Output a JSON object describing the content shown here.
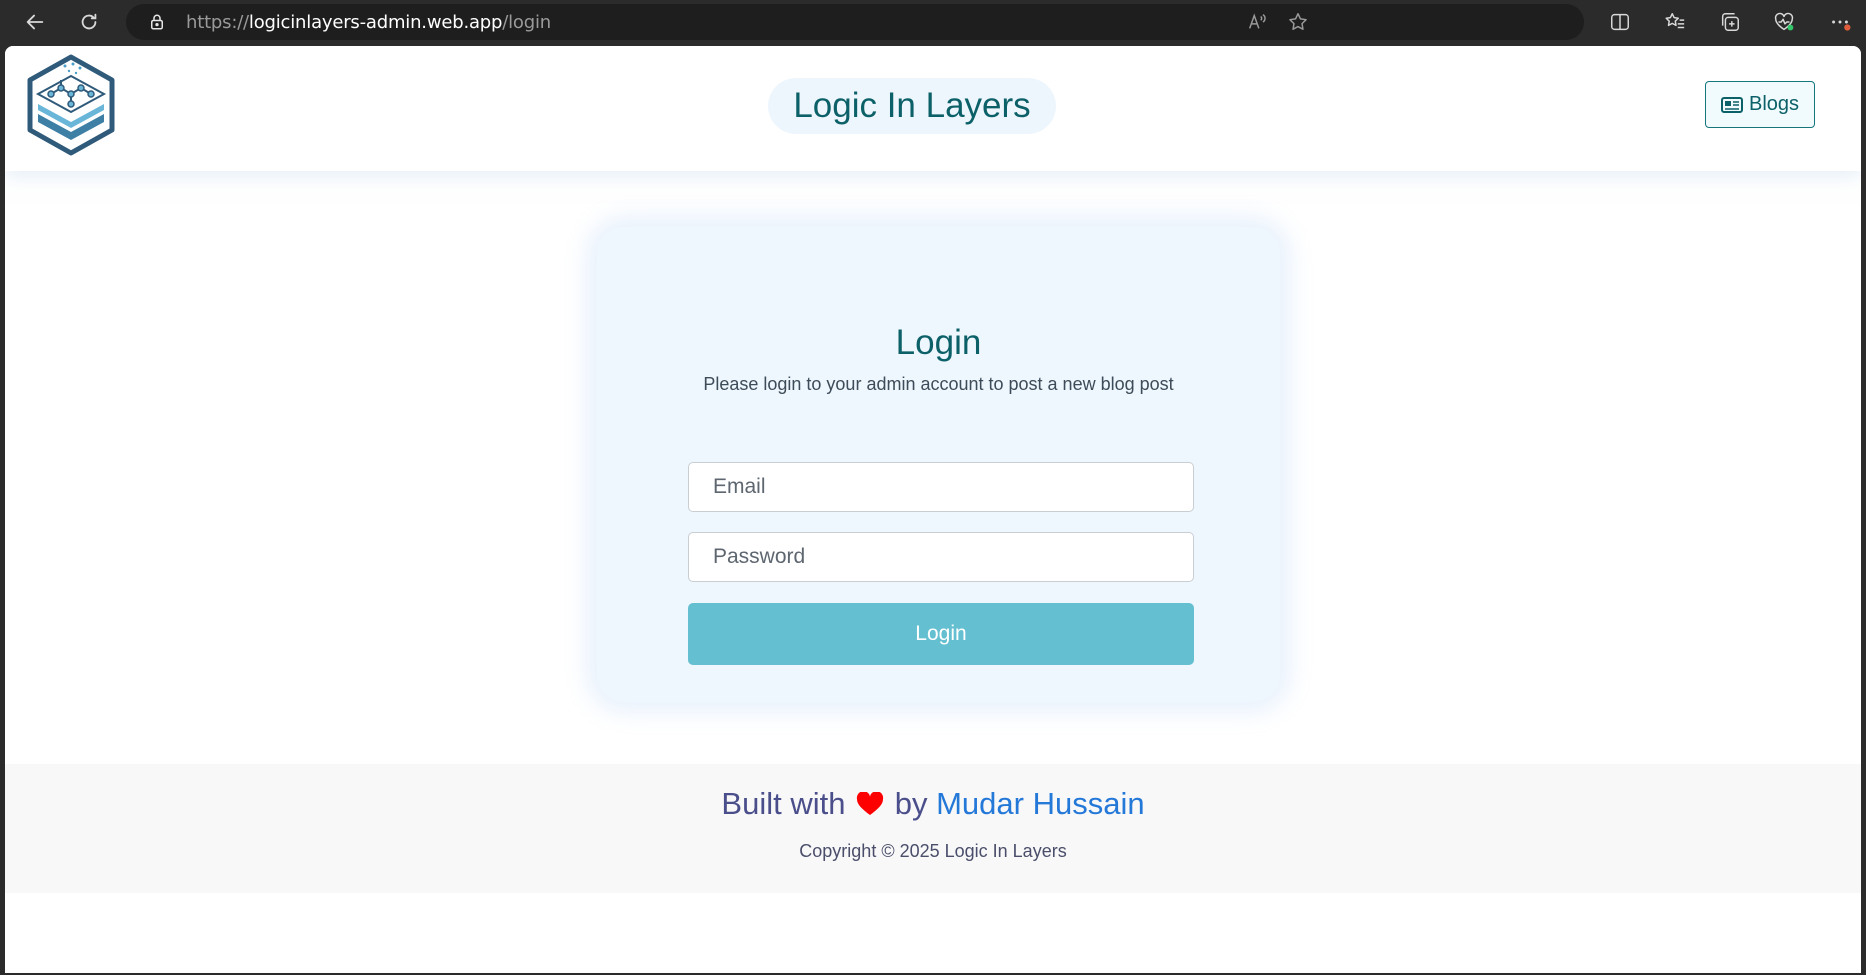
{
  "browser": {
    "url_scheme": "https://",
    "url_host": "logicinlayers-admin.web.app",
    "url_path": "/login",
    "icons": [
      "back-arrow-icon",
      "reload-icon",
      "lock-icon",
      "read-aloud-icon",
      "favorite-star-icon",
      "split-screen-icon",
      "favorites-icon",
      "collections-icon",
      "browser-essentials-icon",
      "more-options-icon"
    ]
  },
  "header": {
    "brand": "Logic In Layers",
    "blogs_label": "Blogs",
    "logo_icon": "layers-circuit-logo",
    "blogs_icon": "newspaper-icon"
  },
  "login": {
    "title": "Login",
    "subtitle": "Please login to your admin account to post a new blog post",
    "email_placeholder": "Email",
    "password_placeholder": "Password",
    "button_label": "Login"
  },
  "footer": {
    "built_with": "Built with",
    "by": "by",
    "author": "Mudar Hussain",
    "copyright": "Copyright © 2025 Logic In Layers"
  },
  "colors": {
    "brand_teal": "#0c6168",
    "login_button": "#64bfd1",
    "card_background": "#eef6fe",
    "heart": "#ff0000",
    "author_link": "#2478d8"
  }
}
